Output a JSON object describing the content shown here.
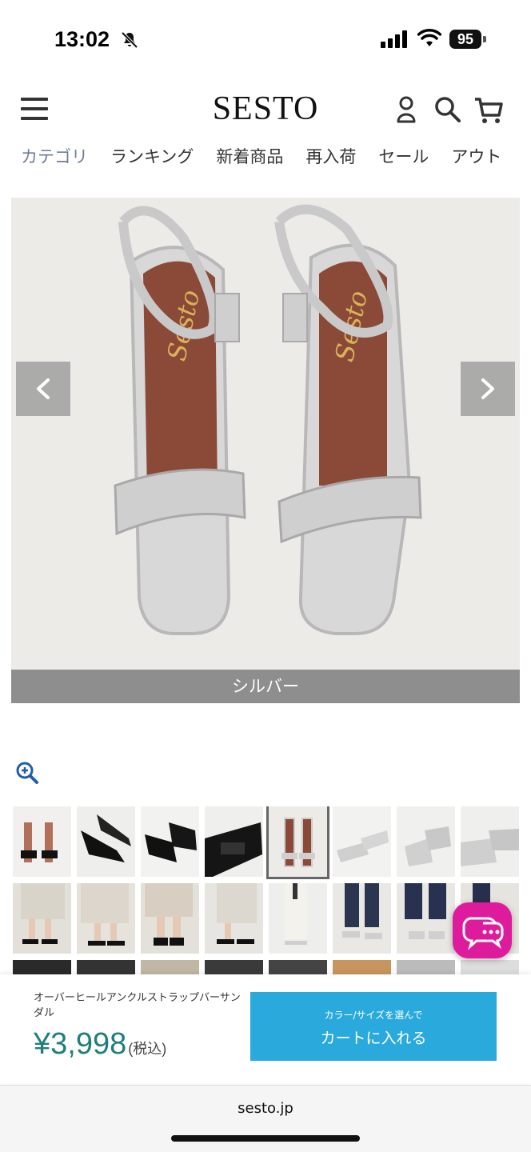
{
  "status_bar": {
    "time": "13:02",
    "battery": "95"
  },
  "header": {
    "logo": "SESTO",
    "nav": [
      "カテゴリ",
      "ランキング",
      "新着商品",
      "再入荷",
      "セール",
      "アウト"
    ]
  },
  "product_image": {
    "caption": "シルバー"
  },
  "purchase": {
    "product_name": "オーバーヒールアンクルストラップバーサンダル",
    "price": "¥3,998",
    "tax_note": "(税込)",
    "cart_sub_label": "カラー/サイズを選んで",
    "cart_label": "カートに入れる"
  },
  "browser": {
    "url": "sesto.jp"
  },
  "colors": {
    "accent": "#2aa9dc",
    "price": "#1f7f7a",
    "chat": "#de1a9d",
    "nav_active": "#6f7d92"
  }
}
